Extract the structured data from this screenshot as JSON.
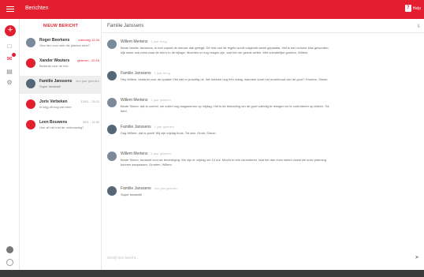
{
  "header": {
    "title": "Berichten",
    "help": "Help"
  },
  "colors": {
    "brand": "#e31e2f"
  },
  "sidebar": {
    "icons": [
      {
        "name": "new-message-fab",
        "glyph": "+"
      },
      {
        "name": "inbox-icon",
        "glyph": "□"
      },
      {
        "name": "messages-icon",
        "glyph": "✉"
      },
      {
        "name": "archive-icon",
        "glyph": "▤"
      },
      {
        "name": "settings-icon",
        "glyph": "⚙"
      }
    ]
  },
  "list": {
    "new_label": "NIEUW BERICHT",
    "conversations": [
      {
        "name": "Roger Beerkens",
        "snippet": "Ons hier voor ziek die planten deer?",
        "time": "zaterdag 12:34",
        "avatar_color": "#7a8a9a"
      },
      {
        "name": "Xander Wouters",
        "snippet": "Bedankt voor de info",
        "time": "gisteren - 20:16",
        "avatar_color": "#e31e2f"
      },
      {
        "name": "Familie Janssens",
        "snippet": "Super bedankt!",
        "time": "een jaar geleden",
        "avatar_color": "#556677"
      },
      {
        "name": "Joris Verbeken",
        "snippet": "Ik krijg dit nog wel mee",
        "time": "12/01 - 13:21",
        "avatar_color": "#e31e2f"
      },
      {
        "name": "Leen Bouwens",
        "snippet": "Hoe zit het met de verbouwing?",
        "time": "5/01 - 11:30",
        "avatar_color": "#e31e2f"
      }
    ]
  },
  "main": {
    "subject": "Familie Janssens",
    "export": "⇩",
    "messages": [
      {
        "author": "Willem Mertens",
        "when": "1 jaar terug",
        "avatar_color": "#7a8a9a",
        "body": "Beste familie Janssens, ik heb zojuist de nieuwe dak gelegd. De rest van de tegels wordt volgende week geplaatst. Het is een schone klus geworden, kijk zeker ook eens naar de foto’s in de bijlage. Mochten er nog vragen zijn, laat het me gerust weten. Met vriendelijke groeten, Willem."
      },
      {
        "author": "Familie Janssens",
        "when": "1 jaar terug",
        "avatar_color": "#556677",
        "body": "Hey Willem, bedankt voor de update! Het ziet er prachtig uit. We hebben nog één vraag: wanneer komt het onderhoud van de goot? Groeten, Simon"
      },
      {
        "author": "Willem Mertens",
        "when": "1 jaar geleden",
        "avatar_color": "#7a8a9a",
        "body": "Beste Simon, dat is correct, we zullen nog langskomen op vrijdag. Het is de bedoeling om de goot volledig te reinigen en te controleren op lekken. Tot dan!"
      },
      {
        "author": "Familie Janssens",
        "when": "1 jaar geleden",
        "avatar_color": "#556677",
        "body": "Dag Willem, dat is goed! Wij zijn vrijdag thuis. Tot dan. Groet, Simon"
      },
      {
        "author": "Willem Mertens",
        "when": "1 jaar geleden",
        "avatar_color": "#7a8a9a",
        "body": "Beste Simon, bedankt voor de bevestiging. We zijn er vrijdag om 10 uur. Mocht er iets veranderen, laat het dan even weten zodat we onze planning kunnen aanpassen. Groeten, Willem."
      },
      {
        "author": "Familie Janssens",
        "when": "een jaar geleden",
        "avatar_color": "#556677",
        "body": "Super bedankt!"
      }
    ],
    "compose_placeholder": "Schrijf een bericht...",
    "send": "➤"
  }
}
